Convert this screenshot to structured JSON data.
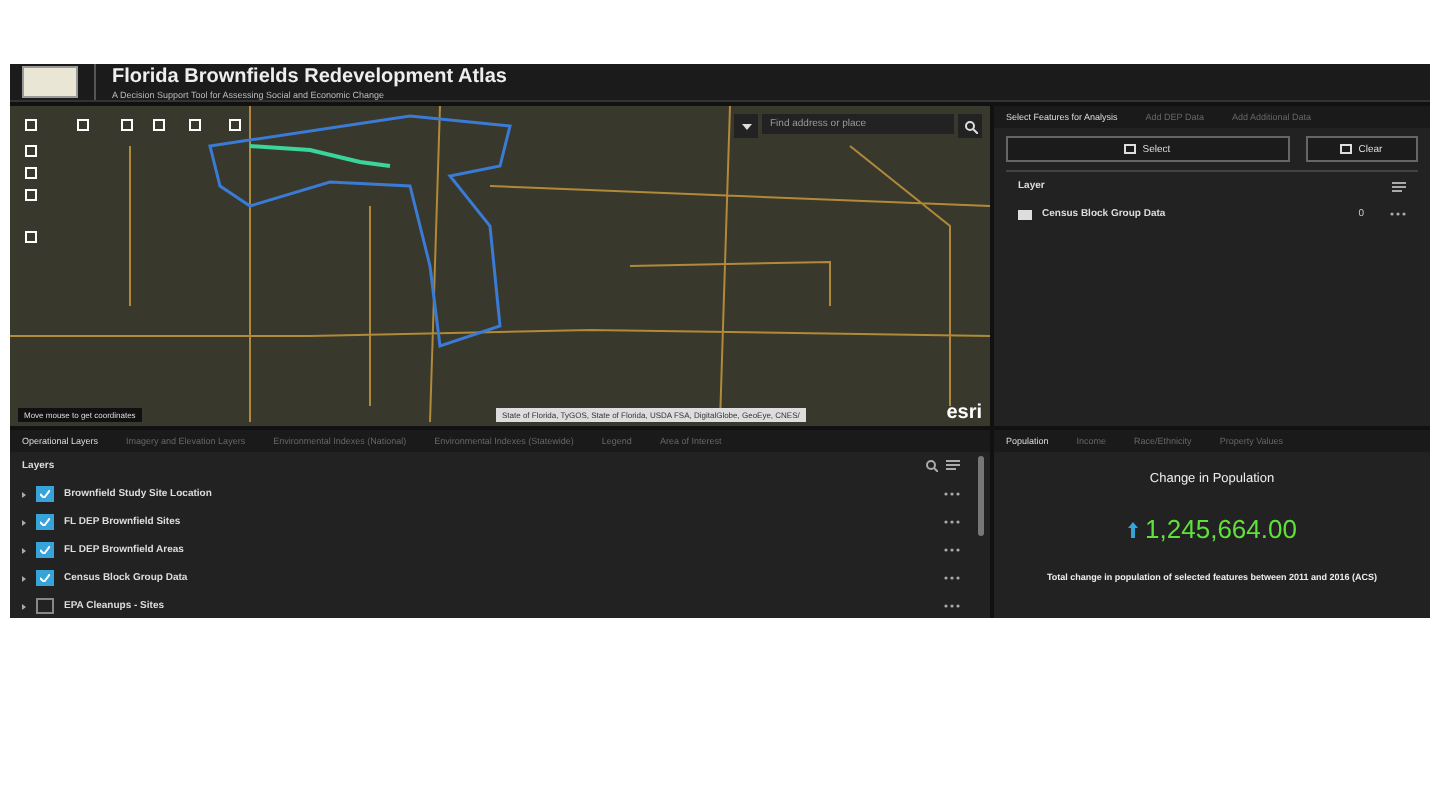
{
  "header": {
    "title": "Florida Brownfields Redevelopment Atlas",
    "subtitle": "A Decision Support Tool for Assessing Social and Economic Change"
  },
  "map": {
    "search": {
      "placeholder": "Find address or place"
    },
    "coordinates": "Move mouse to get coordinates",
    "attribution": "State of Florida, TyGOS, State of Florida, USDA FSA, DigitalGlobe, GeoEye, CNES/",
    "logo": "esri"
  },
  "analysis": {
    "tabs": [
      {
        "label": "Select Features for Analysis",
        "selected": true
      },
      {
        "label": "Add DEP Data",
        "selected": false
      },
      {
        "label": "Add Additional Data",
        "selected": false
      }
    ],
    "buttons": [
      {
        "label": "Select",
        "kind": "select"
      },
      {
        "label": "Clear",
        "kind": "clear"
      }
    ],
    "layer_heading": "Layer",
    "layers": [
      {
        "name": "Census Block Group Data",
        "count": "0"
      }
    ]
  },
  "layer_panel": {
    "tabs": [
      {
        "label": "Operational Layers",
        "selected": true
      },
      {
        "label": "Imagery and Elevation Layers",
        "selected": false
      },
      {
        "label": "Environmental Indexes (National)",
        "selected": false
      },
      {
        "label": "Environmental Indexes (Statewide)",
        "selected": false
      },
      {
        "label": "Legend",
        "selected": false
      },
      {
        "label": "Area of Interest",
        "selected": false
      }
    ],
    "heading": "Layers",
    "layers": [
      {
        "name": "Brownfield Study Site Location",
        "checked": true
      },
      {
        "name": "FL DEP Brownfield Sites",
        "checked": true
      },
      {
        "name": "FL DEP Brownfield Areas",
        "checked": true
      },
      {
        "name": "Census Block Group Data",
        "checked": true
      },
      {
        "name": "EPA Cleanups - Sites",
        "checked": false
      }
    ]
  },
  "stats": {
    "tabs": [
      {
        "label": "Population",
        "selected": true
      },
      {
        "label": "Income",
        "selected": false
      },
      {
        "label": "Race/Ethnicity",
        "selected": false
      },
      {
        "label": "Property Values",
        "selected": false
      }
    ],
    "title": "Change in Population",
    "value": "1,245,664.00",
    "caption": "Total change in population of selected features between 2011 and 2016 (ACS)"
  }
}
